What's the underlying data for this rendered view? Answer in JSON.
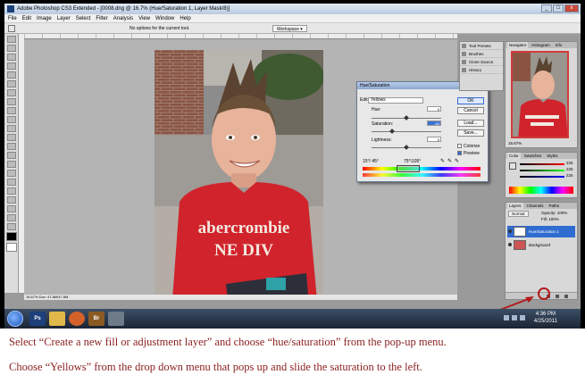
{
  "window": {
    "title": "Adobe Photoshop CS3 Extended - [0008.dng @ 16.7% (Hue/Saturation 1, Layer Mask/8)]",
    "buttons": [
      "_",
      "□",
      "x"
    ]
  },
  "menu": [
    "File",
    "Edit",
    "Image",
    "Layer",
    "Select",
    "Filter",
    "Analysis",
    "View",
    "Window",
    "Help"
  ],
  "options_bar": {
    "hint": "No options for the current tool.",
    "workspace": "Workspace ▾"
  },
  "status_bar": {
    "text": "16.67%      Doc: 47.8M/47.8M"
  },
  "dialog": {
    "title": "Hue/Saturation",
    "edit_label": "Edit:",
    "edit_value": "Yellows",
    "hue_label": "Hue:",
    "hue_value": "0",
    "saturation_label": "Saturation:",
    "saturation_value": "-60",
    "lightness_label": "Lightness:",
    "lightness_value": "0",
    "buttons": [
      "OK",
      "Cancel",
      "Load...",
      "Save..."
    ],
    "colorize": "Colorize",
    "preview": "Preview",
    "range_left": "15°/ 45°",
    "range_right": "75°\\105°",
    "saturation_level": 0.3
  },
  "panels": {
    "tool_presets": [
      "Tool Presets",
      "Brushes",
      "Clone Source",
      "History"
    ],
    "navigator_tabs": [
      "Navigator",
      "Histogram",
      "Info"
    ],
    "navigator_zoom": "16.67%",
    "color_tabs": [
      "Color",
      "Swatches",
      "Styles"
    ],
    "color_values": [
      "225",
      "225",
      "225"
    ],
    "layers_tabs": [
      "Layers",
      "Channels",
      "Paths"
    ],
    "blend_mode": "Normal",
    "opacity": "Opacity: 100%",
    "fill": "Fill: 100%",
    "layers": [
      "Hue/Saturation 1",
      "Background"
    ]
  },
  "taskbar": {
    "apps": [
      "Ps",
      "",
      "",
      "Br",
      ""
    ],
    "time": "4:36 PM",
    "date": "4/25/2011"
  },
  "captions": [
    "Select “Create a new fill or adjustment layer” and choose “hue/saturation” from the pop-up menu.",
    "Choose “Yellows” from the drop down menu that pops up and slide the saturation to the left."
  ],
  "photo": {
    "shirt_line1": "abercrombie",
    "shirt_line2": "NE DIV"
  },
  "colors": {
    "caption": "#8b1f1f",
    "accent": "#b21b1b",
    "shirt": "#d1232c"
  }
}
